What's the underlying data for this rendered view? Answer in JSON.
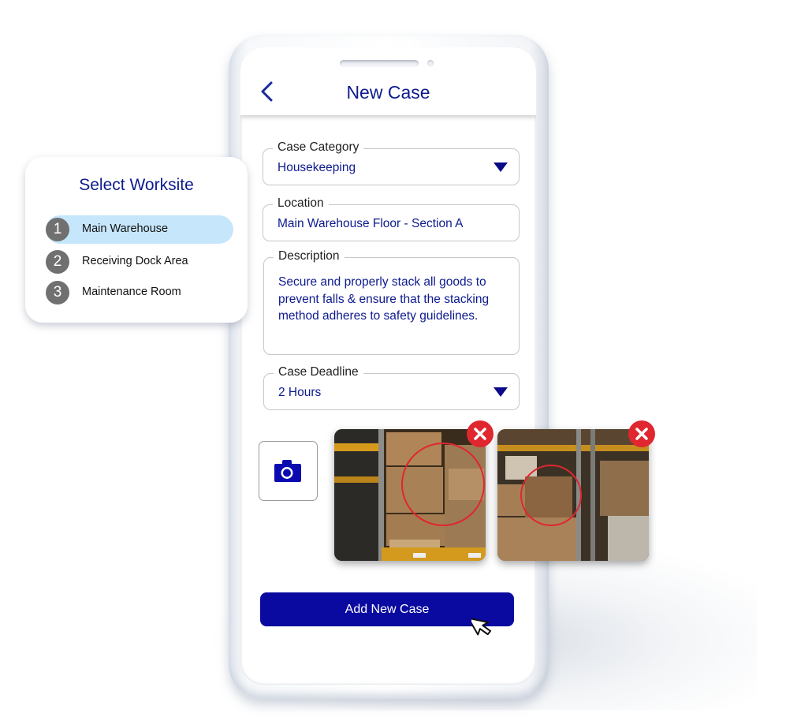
{
  "header": {
    "title": "New Case",
    "back_icon": "chevron-left-icon"
  },
  "form": {
    "case_category": {
      "label": "Case Category",
      "value": "Housekeeping",
      "icon": "caret-down-icon"
    },
    "location": {
      "label": "Location",
      "value": "Main Warehouse Floor - Section A"
    },
    "description": {
      "label": "Description",
      "value": "Secure and properly stack all goods to prevent falls & ensure that the stacking method adheres to safety guidelines."
    },
    "case_deadline": {
      "label": "Case Deadline",
      "value": "2 Hours",
      "icon": "caret-down-icon"
    }
  },
  "attachments": {
    "camera_icon": "camera-icon",
    "photos": [
      {
        "alt": "Warehouse pallet stack with highlighted area",
        "remove_icon": "close-icon"
      },
      {
        "alt": "Warehouse boxes stack with highlighted area",
        "remove_icon": "close-icon"
      }
    ]
  },
  "actions": {
    "add_case_label": "Add New Case"
  },
  "worksite_popup": {
    "title": "Select Worksite",
    "items": [
      {
        "number": "1",
        "label": "Main Warehouse",
        "selected": true
      },
      {
        "number": "2",
        "label": "Receiving Dock Area",
        "selected": false
      },
      {
        "number": "3",
        "label": "Maintenance Room",
        "selected": false
      }
    ]
  },
  "colors": {
    "brand_navy": "#0d1a8e",
    "button_blue": "#0a0aa0",
    "selected_bg": "#c6e6fb",
    "remove_red": "#e0262f"
  }
}
